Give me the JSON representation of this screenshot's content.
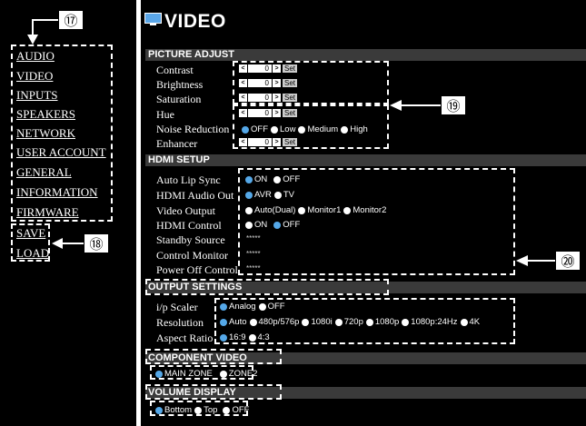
{
  "nav": {
    "items": [
      "AUDIO",
      "VIDEO",
      "INPUTS",
      "SPEAKERS",
      "NETWORK",
      "USER ACCOUNT",
      "GENERAL",
      "INFORMATION",
      "FIRMWARE"
    ],
    "save": "SAVE",
    "load": "LOAD"
  },
  "callouts": {
    "c17": "⑰",
    "c18": "⑱",
    "c19": "⑲",
    "c20": "⑳"
  },
  "page_title": "VIDEO",
  "picture_adjust": {
    "header": "PICTURE ADJUST",
    "contrast": {
      "label": "Contrast",
      "value": "0"
    },
    "brightness": {
      "label": "Brightness",
      "value": "0"
    },
    "saturation": {
      "label": "Saturation",
      "value": "0"
    },
    "hue": {
      "label": "Hue",
      "value": "0"
    },
    "noise_reduction": {
      "label": "Noise Reduction",
      "options": [
        "OFF",
        "Low",
        "Medium",
        "High"
      ],
      "selected": "OFF"
    },
    "enhancer": {
      "label": "Enhancer",
      "value": "0"
    },
    "set_label": "Set",
    "dec_symbol": "<",
    "inc_symbol": ">"
  },
  "hdmi_setup": {
    "header": "HDMI SETUP",
    "auto_lip_sync": {
      "label": "Auto Lip Sync",
      "options": [
        "ON",
        "OFF"
      ],
      "selected": "ON"
    },
    "hdmi_audio_out": {
      "label": "HDMI Audio Out",
      "options": [
        "AVR",
        "TV"
      ],
      "selected": "AVR"
    },
    "video_output": {
      "label": "Video Output",
      "options": [
        "Auto(Dual)",
        "Monitor1",
        "Monitor2"
      ],
      "selected": null
    },
    "hdmi_control": {
      "label": "HDMI Control",
      "options": [
        "ON",
        "OFF"
      ],
      "selected": "OFF"
    },
    "standby_source": {
      "label": "Standby Source",
      "value": "*****"
    },
    "control_monitor": {
      "label": "Control Monitor",
      "value": "*****"
    },
    "power_off_control": {
      "label": "Power Off Control",
      "value": "*****"
    }
  },
  "output_settings": {
    "header": "OUTPUT SETTINGS",
    "ip_scaler": {
      "label": "i/p Scaler",
      "options": [
        "Analog",
        "OFF"
      ],
      "selected": "Analog"
    },
    "resolution": {
      "label": "Resolution",
      "options": [
        "Auto",
        "480p/576p",
        "1080i",
        "720p",
        "1080p",
        "1080p:24Hz",
        "4K"
      ],
      "selected": "Auto"
    },
    "aspect_ratio": {
      "label": "Aspect Ratio",
      "options": [
        "16:9",
        "4:3"
      ],
      "selected": "16:9"
    }
  },
  "component_video": {
    "header": "COMPONENT VIDEO",
    "options": [
      "MAIN ZONE",
      "ZONE2"
    ],
    "selected": "MAIN ZONE"
  },
  "volume_display": {
    "header": "VOLUME DISPLAY",
    "options": [
      "Bottom",
      "Top",
      "OFF"
    ],
    "selected": "Bottom"
  },
  "colors": {
    "background": "#000000",
    "section_bar": "#3a3a3a",
    "radio_selected": "#55a8e8",
    "text": "#ffffff"
  }
}
